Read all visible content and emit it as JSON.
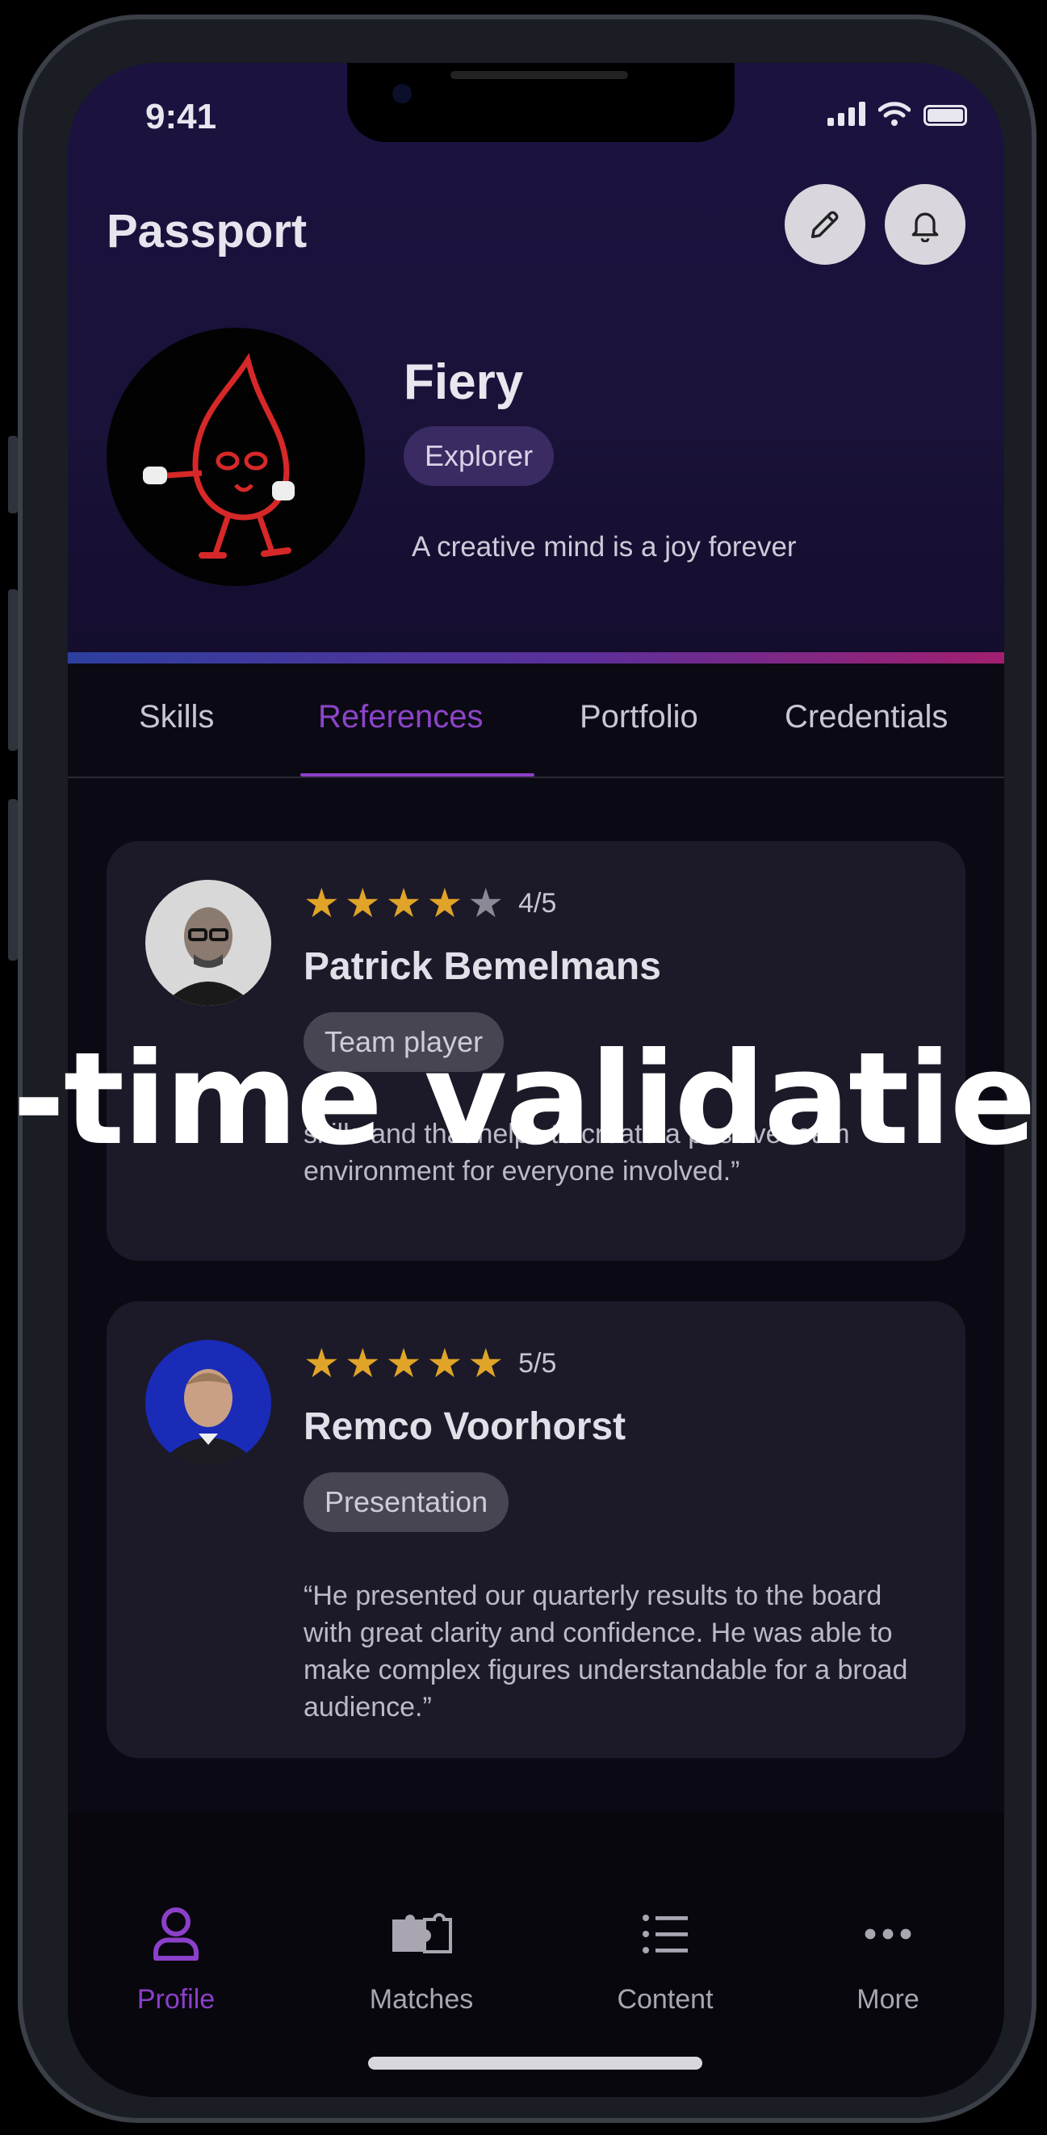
{
  "status_bar": {
    "time": "9:41"
  },
  "header": {
    "title": "Passport"
  },
  "profile": {
    "name": "Fiery",
    "role": "Explorer",
    "bio": "A creative mind is a joy forever"
  },
  "tabs": [
    {
      "label": "Skills"
    },
    {
      "label": "References"
    },
    {
      "label": "Portfolio"
    },
    {
      "label": "Credentials"
    }
  ],
  "active_tab": "References",
  "references": [
    {
      "name": "Patrick Bemelmans",
      "rating": 4,
      "rating_text": "4/5",
      "skill": "Team player",
      "quote": "skills and that helps to create a positive team environment for everyone involved.”"
    },
    {
      "name": "Remco Voorhorst",
      "rating": 5,
      "rating_text": "5/5",
      "skill": "Presentation",
      "quote": "“He presented our quarterly results to the board with great clarity and confidence. He was able to make complex figures understandable for a broad audience.”"
    }
  ],
  "bottom_nav": [
    {
      "label": "Profile",
      "icon": "person-icon"
    },
    {
      "label": "Matches",
      "icon": "puzzle-icon"
    },
    {
      "label": "Content",
      "icon": "list-icon"
    },
    {
      "label": "More",
      "icon": "more-dots-icon"
    }
  ],
  "overlay_caption": "-time validatie",
  "colors": {
    "accent": "#8c3fc8",
    "star": "#e0a428",
    "background": "#0b0a14",
    "card": "#1c1a28"
  }
}
